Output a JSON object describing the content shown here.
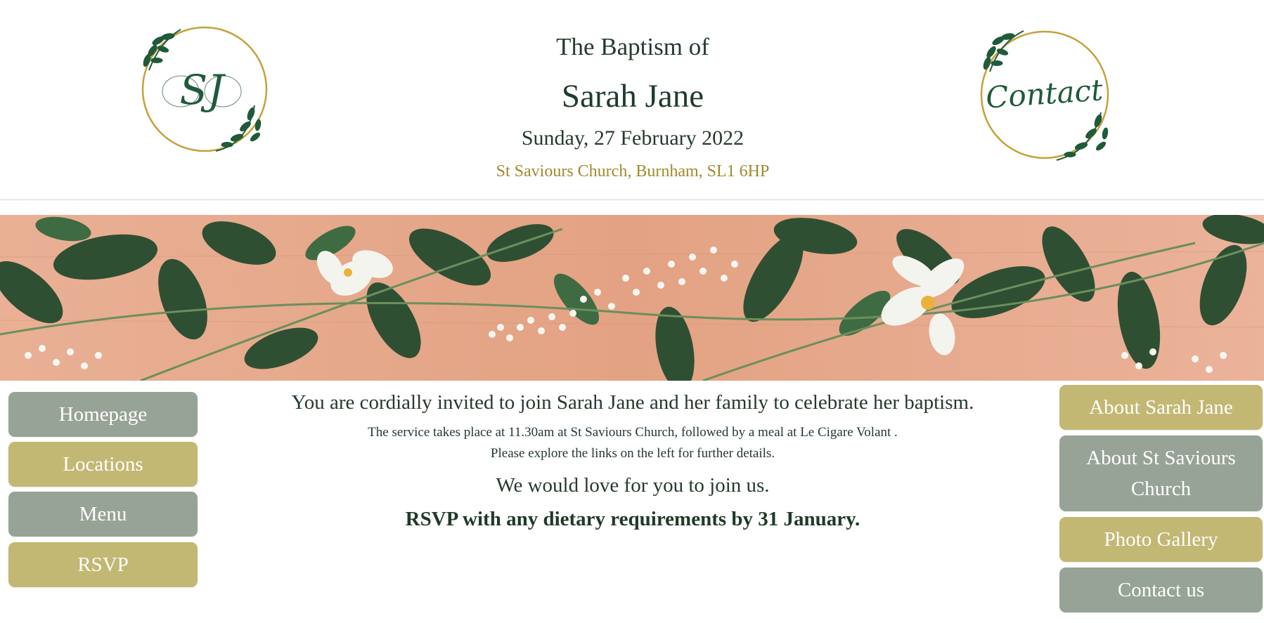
{
  "header": {
    "title_line1": "The Baptism of",
    "name": "Sarah Jane",
    "date": "Sunday, 27 February 2022",
    "location": "St Saviours Church, Burnham, SL1 6HP",
    "left_logo_text": "SJ",
    "left_logo_icon": "monogram-wreath-icon",
    "right_logo_text": "Contact",
    "right_logo_icon": "contact-wreath-icon"
  },
  "banner": {
    "icon": "floral-banner-image",
    "colors": {
      "wood": "#e7a98a",
      "leaf": "#2f4f33",
      "flower": "#f4f4ee"
    }
  },
  "left_nav": [
    {
      "label": "Homepage",
      "color": "sage"
    },
    {
      "label": "Locations",
      "color": "gold"
    },
    {
      "label": "Menu",
      "color": "sage"
    },
    {
      "label": "RSVP",
      "color": "gold"
    }
  ],
  "right_nav": [
    {
      "label": "About Sarah Jane",
      "color": "gold"
    },
    {
      "label": "About St Saviours Church",
      "color": "sage"
    },
    {
      "label": "Photo Gallery",
      "color": "gold"
    },
    {
      "label": "Contact us",
      "color": "sage"
    }
  ],
  "content": {
    "invite": "You are cordially invited to join Sarah Jane and her family to celebrate her baptism.",
    "service_line1": "The service takes place at 11.30am at St Saviours Church, followed by a meal at Le Cigare Volant .",
    "service_line2": "Please explore the links on the left for further details.",
    "join": "We would love for you to join us.",
    "rsvp": "RSVP with any dietary requirements by 31 January."
  },
  "colors": {
    "sage": "#97a397",
    "gold": "#c3b774",
    "dark_green": "#1f3c2a",
    "gold_text": "#a08a2c"
  }
}
